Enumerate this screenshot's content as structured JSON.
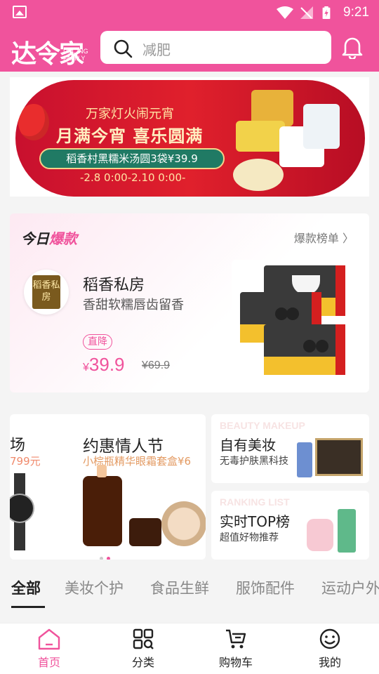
{
  "status_bar": {
    "time": "9:21"
  },
  "header": {
    "logo": "达令家",
    "logo_sub_1": "DAL ING",
    "logo_sub_2": "FAMILY",
    "search_placeholder": "减肥"
  },
  "banner": {
    "line1": "万家灯火闹元宵",
    "line2": "月满今宵 喜乐圆满",
    "pill": "稻香村黑糯米汤圆3袋¥39.9",
    "date": "-2.8 0:00-2.10 0:00-"
  },
  "today_hot": {
    "title_a": "今日",
    "title_b": "爆款",
    "more": "爆款榜单 〉",
    "brand_logo_text": "稻香私房",
    "name": "稻香私房",
    "desc": "香甜软糯唇齿留香",
    "badge": "直降",
    "price_symbol": "¥",
    "price": "39.9",
    "old_price": "¥69.9"
  },
  "activities": {
    "left_prev_title": "场",
    "left_prev_sub": "799元",
    "left_title": "约惠情人节",
    "left_sub": "小棕瓶精华眼霜套盒¥6",
    "right_top": {
      "bg": "BEAUTY MAKEUP",
      "title": "自有美妆",
      "sub": "无毒护肤黑科技"
    },
    "right_bottom": {
      "bg": "RANKING LIST",
      "title": "实时TOP榜",
      "sub": "超值好物推荐"
    }
  },
  "tabs": [
    "全部",
    "美妆个护",
    "食品生鲜",
    "服饰配件",
    "运动户外"
  ],
  "nav": [
    {
      "label": "首页",
      "icon": "home-icon"
    },
    {
      "label": "分类",
      "icon": "category-icon"
    },
    {
      "label": "购物车",
      "icon": "cart-icon"
    },
    {
      "label": "我的",
      "icon": "profile-icon"
    }
  ],
  "colors": {
    "brand": "#f0539c",
    "price": "#f0539c"
  }
}
